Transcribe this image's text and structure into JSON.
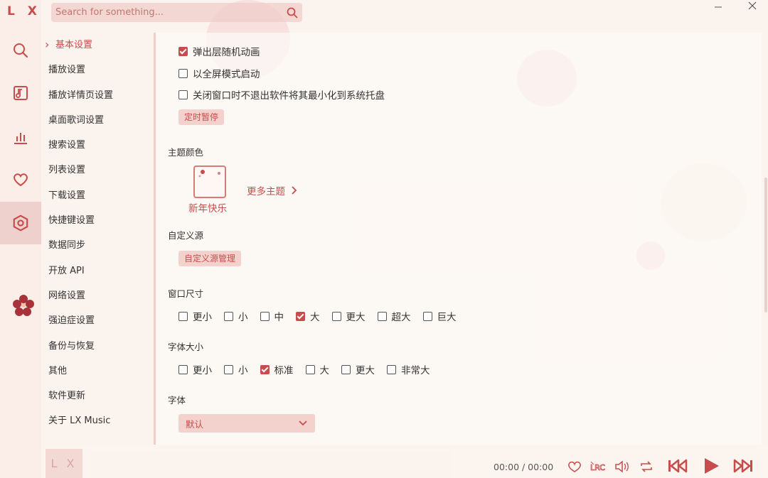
{
  "app": {
    "logo": "L X"
  },
  "search": {
    "placeholder": "Search for something..."
  },
  "rail": {
    "items": [
      {
        "icon": "search-icon"
      },
      {
        "icon": "music-icon"
      },
      {
        "icon": "chart-icon"
      },
      {
        "icon": "heart-icon"
      },
      {
        "icon": "settings-icon",
        "active": true
      }
    ]
  },
  "settings_nav": {
    "items": [
      "基本设置",
      "播放设置",
      "播放详情页设置",
      "桌面歌词设置",
      "搜索设置",
      "列表设置",
      "下载设置",
      "快捷键设置",
      "数据同步",
      "开放 API",
      "网络设置",
      "强迫症设置",
      "备份与恢复",
      "其他",
      "软件更新",
      "关于 LX Music"
    ],
    "active_index": 0
  },
  "basic": {
    "checkbox_random_anim": "弹出层随机动画",
    "checkbox_fullscreen": "以全屏模式启动",
    "checkbox_tray": "关闭窗口时不退出软件将其最小化到系统托盘",
    "timer_button": "定时暂停",
    "theme_title": "主题颜色",
    "theme_name": "新年快乐",
    "more_theme": "更多主题",
    "source_title": "自定义源",
    "source_button": "自定义源管理",
    "window_size_title": "窗口尺寸",
    "window_sizes": [
      "更小",
      "小",
      "中",
      "大",
      "更大",
      "超大",
      "巨大"
    ],
    "window_size_selected": 3,
    "font_size_title": "字体大小",
    "font_sizes": [
      "更小",
      "小",
      "标准",
      "大",
      "更大",
      "非常大"
    ],
    "font_size_selected": 2,
    "font_title": "字体",
    "font_value": "默认"
  },
  "player": {
    "cover_text": "L X",
    "time": "00:00 / 00:00"
  },
  "colors": {
    "accent": "#c94c4c",
    "bg": "#fbf3ee"
  }
}
